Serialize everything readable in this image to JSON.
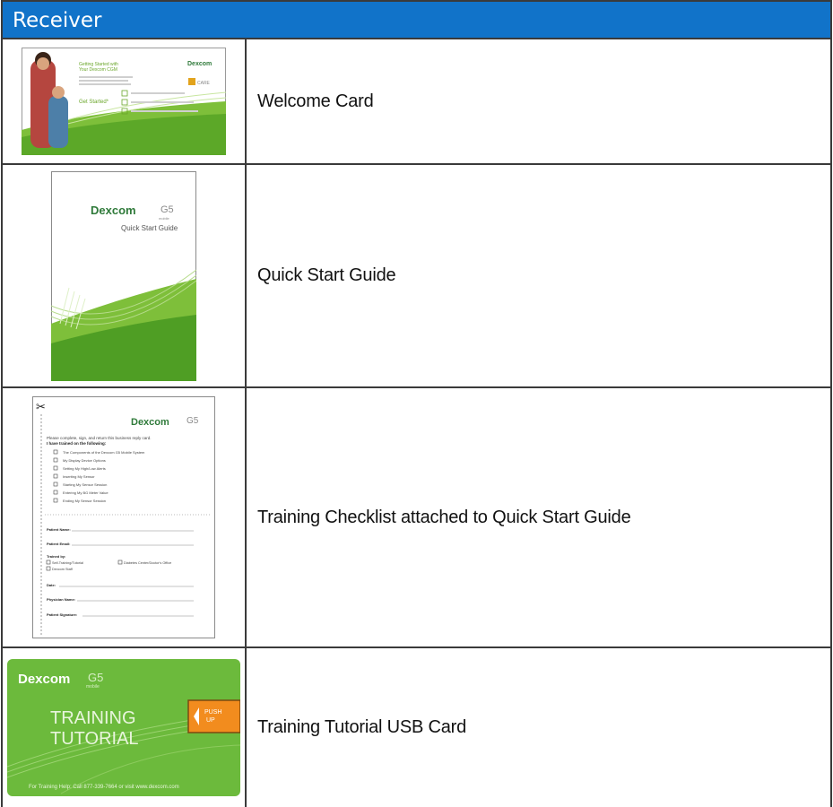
{
  "header": {
    "title": "Receiver"
  },
  "rows": [
    {
      "label": "Welcome Card",
      "image": {
        "brand": "Dexcom",
        "heading_line1": "Getting Started with",
        "heading_line2": "Your Dexcom CGM",
        "cta": "Get Started*",
        "badge": "CARE"
      }
    },
    {
      "label": "Quick Start Guide",
      "image": {
        "brand": "Dexcom",
        "product": "G5",
        "product_sub": "mobile",
        "title": "Quick Start Guide"
      }
    },
    {
      "label": "Training Checklist attached to Quick Start Guide",
      "image": {
        "brand": "Dexcom",
        "product": "G5",
        "intro_line1": "Please complete, sign, and return this business reply card.",
        "intro_line2": "I have trained on the following:",
        "items": [
          "The Components of the Dexcom G5 Mobile System",
          "My Display Device Options",
          "Setting My High/Low Alerts",
          "Inserting My Sensor",
          "Starting My Sensor Session",
          "Entering My BG Meter Value",
          "Ending My Sensor Session"
        ],
        "fields": [
          "Patient Name:",
          "Patient Email:"
        ],
        "trained_by": "Trained by:",
        "trained_options": [
          "Self-Training/Tutorial",
          "Diabetes Center/Doctor's Office",
          "Dexcom Staff"
        ],
        "fields2": [
          "Date:",
          "Physician Name:",
          "Patient Signature:"
        ]
      }
    },
    {
      "label": "Training Tutorial USB Card",
      "image": {
        "brand": "Dexcom",
        "product": "G5",
        "product_sub": "mobile",
        "title_line1": "TRAINING",
        "title_line2": "TUTORIAL",
        "tab_line1": "PUSH",
        "tab_line2": "UP",
        "footer": "For Training Help: Call 877-339-7664 or visit www.dexcom.com"
      }
    }
  ]
}
